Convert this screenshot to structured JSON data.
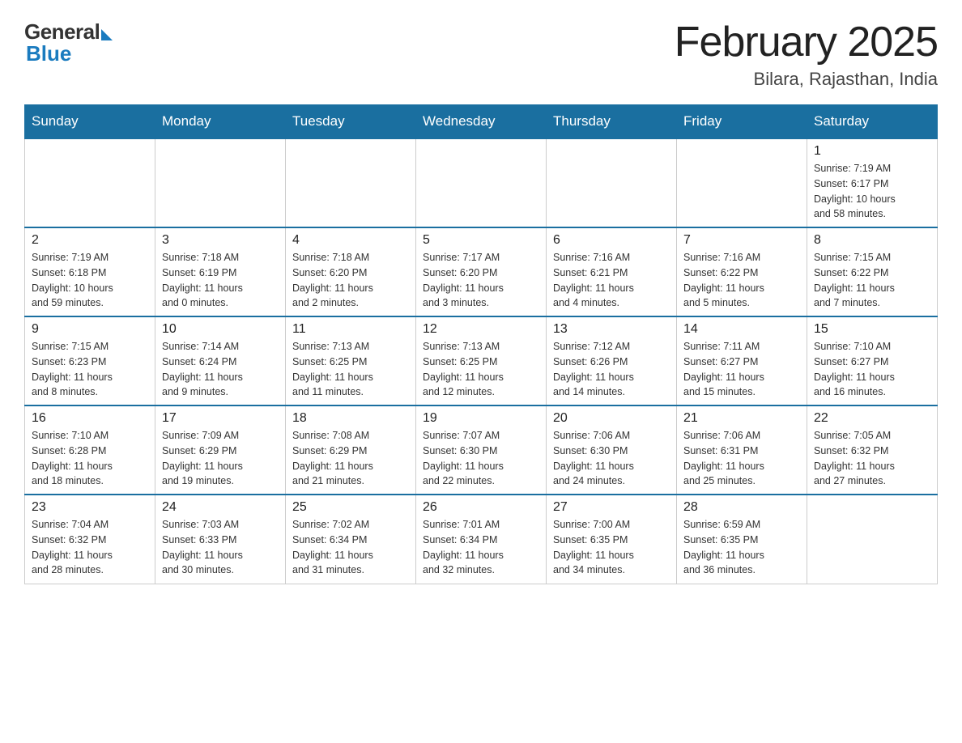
{
  "logo": {
    "general": "General",
    "blue": "Blue"
  },
  "header": {
    "month_year": "February 2025",
    "location": "Bilara, Rajasthan, India"
  },
  "weekdays": [
    "Sunday",
    "Monday",
    "Tuesday",
    "Wednesday",
    "Thursday",
    "Friday",
    "Saturday"
  ],
  "weeks": [
    [
      {
        "day": "",
        "info": ""
      },
      {
        "day": "",
        "info": ""
      },
      {
        "day": "",
        "info": ""
      },
      {
        "day": "",
        "info": ""
      },
      {
        "day": "",
        "info": ""
      },
      {
        "day": "",
        "info": ""
      },
      {
        "day": "1",
        "info": "Sunrise: 7:19 AM\nSunset: 6:17 PM\nDaylight: 10 hours\nand 58 minutes."
      }
    ],
    [
      {
        "day": "2",
        "info": "Sunrise: 7:19 AM\nSunset: 6:18 PM\nDaylight: 10 hours\nand 59 minutes."
      },
      {
        "day": "3",
        "info": "Sunrise: 7:18 AM\nSunset: 6:19 PM\nDaylight: 11 hours\nand 0 minutes."
      },
      {
        "day": "4",
        "info": "Sunrise: 7:18 AM\nSunset: 6:20 PM\nDaylight: 11 hours\nand 2 minutes."
      },
      {
        "day": "5",
        "info": "Sunrise: 7:17 AM\nSunset: 6:20 PM\nDaylight: 11 hours\nand 3 minutes."
      },
      {
        "day": "6",
        "info": "Sunrise: 7:16 AM\nSunset: 6:21 PM\nDaylight: 11 hours\nand 4 minutes."
      },
      {
        "day": "7",
        "info": "Sunrise: 7:16 AM\nSunset: 6:22 PM\nDaylight: 11 hours\nand 5 minutes."
      },
      {
        "day": "8",
        "info": "Sunrise: 7:15 AM\nSunset: 6:22 PM\nDaylight: 11 hours\nand 7 minutes."
      }
    ],
    [
      {
        "day": "9",
        "info": "Sunrise: 7:15 AM\nSunset: 6:23 PM\nDaylight: 11 hours\nand 8 minutes."
      },
      {
        "day": "10",
        "info": "Sunrise: 7:14 AM\nSunset: 6:24 PM\nDaylight: 11 hours\nand 9 minutes."
      },
      {
        "day": "11",
        "info": "Sunrise: 7:13 AM\nSunset: 6:25 PM\nDaylight: 11 hours\nand 11 minutes."
      },
      {
        "day": "12",
        "info": "Sunrise: 7:13 AM\nSunset: 6:25 PM\nDaylight: 11 hours\nand 12 minutes."
      },
      {
        "day": "13",
        "info": "Sunrise: 7:12 AM\nSunset: 6:26 PM\nDaylight: 11 hours\nand 14 minutes."
      },
      {
        "day": "14",
        "info": "Sunrise: 7:11 AM\nSunset: 6:27 PM\nDaylight: 11 hours\nand 15 minutes."
      },
      {
        "day": "15",
        "info": "Sunrise: 7:10 AM\nSunset: 6:27 PM\nDaylight: 11 hours\nand 16 minutes."
      }
    ],
    [
      {
        "day": "16",
        "info": "Sunrise: 7:10 AM\nSunset: 6:28 PM\nDaylight: 11 hours\nand 18 minutes."
      },
      {
        "day": "17",
        "info": "Sunrise: 7:09 AM\nSunset: 6:29 PM\nDaylight: 11 hours\nand 19 minutes."
      },
      {
        "day": "18",
        "info": "Sunrise: 7:08 AM\nSunset: 6:29 PM\nDaylight: 11 hours\nand 21 minutes."
      },
      {
        "day": "19",
        "info": "Sunrise: 7:07 AM\nSunset: 6:30 PM\nDaylight: 11 hours\nand 22 minutes."
      },
      {
        "day": "20",
        "info": "Sunrise: 7:06 AM\nSunset: 6:30 PM\nDaylight: 11 hours\nand 24 minutes."
      },
      {
        "day": "21",
        "info": "Sunrise: 7:06 AM\nSunset: 6:31 PM\nDaylight: 11 hours\nand 25 minutes."
      },
      {
        "day": "22",
        "info": "Sunrise: 7:05 AM\nSunset: 6:32 PM\nDaylight: 11 hours\nand 27 minutes."
      }
    ],
    [
      {
        "day": "23",
        "info": "Sunrise: 7:04 AM\nSunset: 6:32 PM\nDaylight: 11 hours\nand 28 minutes."
      },
      {
        "day": "24",
        "info": "Sunrise: 7:03 AM\nSunset: 6:33 PM\nDaylight: 11 hours\nand 30 minutes."
      },
      {
        "day": "25",
        "info": "Sunrise: 7:02 AM\nSunset: 6:34 PM\nDaylight: 11 hours\nand 31 minutes."
      },
      {
        "day": "26",
        "info": "Sunrise: 7:01 AM\nSunset: 6:34 PM\nDaylight: 11 hours\nand 32 minutes."
      },
      {
        "day": "27",
        "info": "Sunrise: 7:00 AM\nSunset: 6:35 PM\nDaylight: 11 hours\nand 34 minutes."
      },
      {
        "day": "28",
        "info": "Sunrise: 6:59 AM\nSunset: 6:35 PM\nDaylight: 11 hours\nand 36 minutes."
      },
      {
        "day": "",
        "info": ""
      }
    ]
  ]
}
